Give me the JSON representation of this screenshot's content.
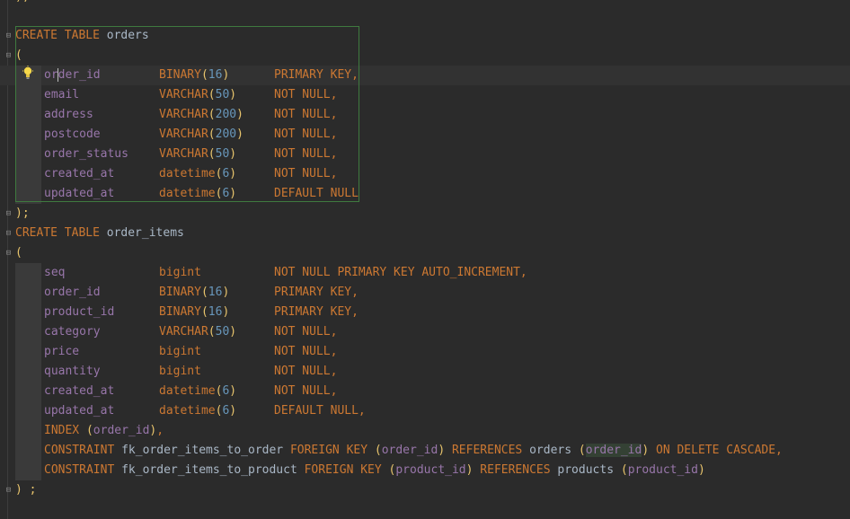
{
  "editor": {
    "tables": [
      {
        "header": {
          "kw": "CREATE TABLE",
          "name": "orders"
        },
        "open": "(",
        "close": ");",
        "columns": [
          {
            "name_pre": "or",
            "name_post": "der_id",
            "type": "BINARY",
            "arg": "16",
            "constraint": "PRIMARY KEY,"
          },
          {
            "name": "email",
            "type": "VARCHAR",
            "arg": "50",
            "constraint": "NOT NULL,"
          },
          {
            "name": "address",
            "type": "VARCHAR",
            "arg": "200",
            "constraint": "NOT NULL,"
          },
          {
            "name": "postcode",
            "type": "VARCHAR",
            "arg": "200",
            "constraint": "NOT NULL,"
          },
          {
            "name": "order_status",
            "type": "VARCHAR",
            "arg": "50",
            "constraint": "NOT NULL,"
          },
          {
            "name": "created_at",
            "type": "datetime",
            "arg": "6",
            "constraint": "NOT NULL,"
          },
          {
            "name": "updated_at",
            "type": "datetime",
            "arg": "6",
            "constraint": "DEFAULT NULL"
          }
        ]
      },
      {
        "header": {
          "kw": "CREATE TABLE",
          "name": "order_items"
        },
        "open": "(",
        "close": ") ;",
        "columns": [
          {
            "name": "seq",
            "type": "bigint",
            "constraint": "NOT NULL PRIMARY KEY AUTO_INCREMENT,"
          },
          {
            "name": "order_id",
            "type": "BINARY",
            "arg": "16",
            "constraint": "PRIMARY KEY,"
          },
          {
            "name": "product_id",
            "type": "BINARY",
            "arg": "16",
            "constraint": "PRIMARY KEY,"
          },
          {
            "name": "category",
            "type": "VARCHAR",
            "arg": "50",
            "constraint": "NOT NULL,"
          },
          {
            "name": "price",
            "type": "bigint",
            "constraint": "NOT NULL,"
          },
          {
            "name": "quantity",
            "type": "bigint",
            "constraint": "NOT NULL,"
          },
          {
            "name": "created_at",
            "type": "datetime",
            "arg": "6",
            "constraint": "NOT NULL,"
          },
          {
            "name": "updated_at",
            "type": "datetime",
            "arg": "6",
            "constraint": "DEFAULT NULL,"
          }
        ],
        "index": {
          "kw": "INDEX",
          "col": "order_id"
        },
        "constraints": [
          {
            "kw": "CONSTRAINT",
            "name": "fk_order_items_to_order",
            "fk": "FOREIGN KEY",
            "col": "order_id",
            "ref": "REFERENCES",
            "table": "orders",
            "refcol": "order_id",
            "tail": "ON DELETE CASCADE,"
          },
          {
            "kw": "CONSTRAINT",
            "name": "fk_order_items_to_product",
            "fk": "FOREIGN KEY",
            "col": "product_id",
            "ref": "REFERENCES",
            "table": "products",
            "refcol": "product_id",
            "tail": ""
          }
        ]
      }
    ],
    "top_fragment": ");",
    "lparen": "(",
    "rparen": ")",
    "comma": ","
  },
  "colors": {
    "keyword": "#cc7832",
    "field": "#9876aa",
    "number": "#6897bb",
    "plain": "#a9b7c6",
    "background": "#2b2b2b"
  },
  "icons": [
    "lightbulb-icon",
    "fold-icon"
  ]
}
